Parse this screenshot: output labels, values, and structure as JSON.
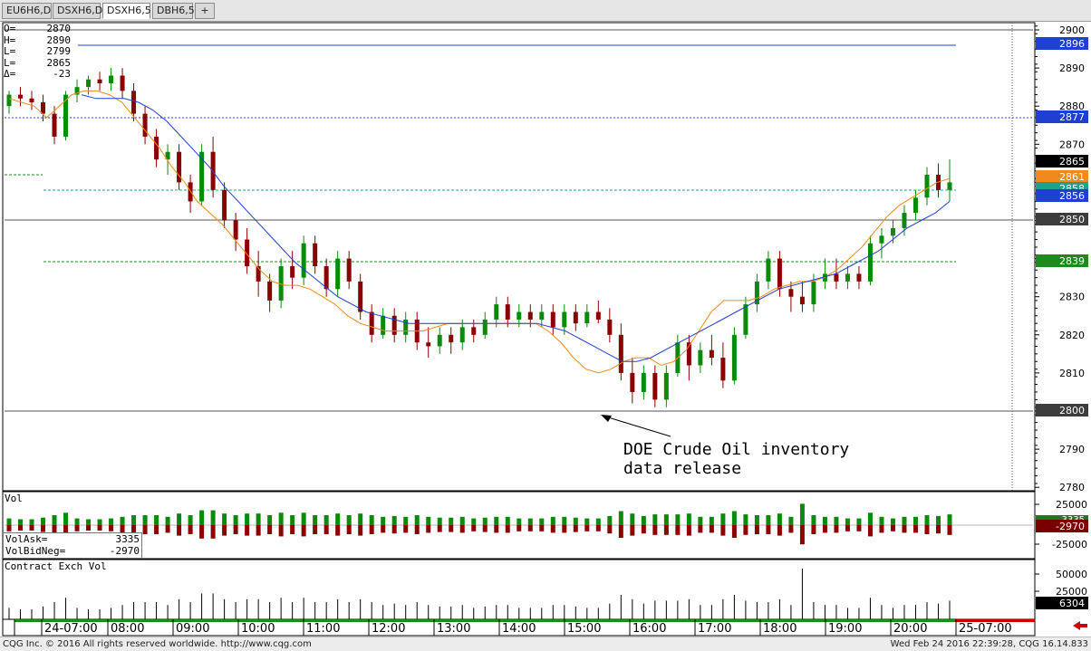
{
  "tabs": [
    {
      "label": "EU6H6,D",
      "active": false
    },
    {
      "label": "DSXH6,D",
      "active": false
    },
    {
      "label": "DSXH6,5",
      "active": true
    },
    {
      "label": "DBH6,5",
      "active": false
    },
    {
      "label": "+",
      "active": false
    }
  ],
  "ohlc": [
    {
      "label": "O=",
      "value": "2870"
    },
    {
      "label": "H=",
      "value": "2890"
    },
    {
      "label": "L=",
      "value": "2799"
    },
    {
      "label": "L=",
      "value": "2865"
    },
    {
      "label": "Δ=",
      "value": "-23"
    }
  ],
  "annotation": {
    "line1": "DOE Crude Oil inventory",
    "line2": "data release"
  },
  "price_axis": {
    "ticks": [
      "2900",
      "2890",
      "2880",
      "2870",
      "2860",
      "2850",
      "2840",
      "2830",
      "2820",
      "2810",
      "2800",
      "2790",
      "2780"
    ],
    "tags": [
      {
        "value": "2896",
        "color": "#1f3fd0"
      },
      {
        "value": "2877",
        "color": "#1f3fd0"
      },
      {
        "value": "2865",
        "color": "#000000"
      },
      {
        "value": "2861",
        "color": "#f08a1c"
      },
      {
        "value": "2858",
        "color": "#1fa090"
      },
      {
        "value": "2856",
        "color": "#1f3fd0"
      },
      {
        "value": "2850",
        "color": "#3c3c3c"
      },
      {
        "value": "2839",
        "color": "#1e8a1e"
      },
      {
        "value": "2800",
        "color": "#3c3c3c"
      }
    ]
  },
  "volume_panel": {
    "title": "Vol",
    "ticks": [
      "25000",
      "-25000"
    ],
    "tag_pos": "3335",
    "tag_neg": "-2970",
    "legend": [
      {
        "label": "VolAsk=",
        "value": "3335"
      },
      {
        "label": "VolBidNeg=",
        "value": "-2970"
      }
    ]
  },
  "contract_panel": {
    "title": "Contract Exch Vol",
    "ticks": [
      "50000",
      "25000"
    ],
    "tag": "6304"
  },
  "time_axis": [
    "24-07:00",
    "08:00",
    "09:00",
    "10:00",
    "11:00",
    "12:00",
    "13:00",
    "14:00",
    "15:00",
    "16:00",
    "17:00",
    "18:00",
    "19:00",
    "20:00",
    "25-07:00"
  ],
  "status": {
    "left": "CQG Inc. © 2016 All rights reserved worldwide. http://www.cqg.com",
    "right": "Wed Feb 24 2016 22:39:28, CQG 16.14.833"
  },
  "colors": {
    "up": "#0a8a0a",
    "down": "#8b0000",
    "ma_fast": "#f08a1c",
    "ma_slow": "#1f3fd0",
    "accent_red": "#cc0000"
  },
  "chart_data": {
    "type": "candlestick",
    "ylim": [
      2775,
      2903
    ],
    "candles": [
      [
        2880,
        2884,
        2878,
        2883
      ],
      [
        2883,
        2885,
        2880,
        2882
      ],
      [
        2882,
        2884,
        2879,
        2881
      ],
      [
        2881,
        2883,
        2876,
        2878
      ],
      [
        2878,
        2880,
        2870,
        2872
      ],
      [
        2872,
        2884,
        2871,
        2883
      ],
      [
        2883,
        2887,
        2881,
        2885
      ],
      [
        2885,
        2888,
        2883,
        2887
      ],
      [
        2887,
        2889,
        2884,
        2886
      ],
      [
        2886,
        2890,
        2884,
        2888
      ],
      [
        2888,
        2890,
        2882,
        2884
      ],
      [
        2884,
        2886,
        2876,
        2878
      ],
      [
        2878,
        2880,
        2870,
        2872
      ],
      [
        2872,
        2874,
        2864,
        2866
      ],
      [
        2866,
        2870,
        2862,
        2868
      ],
      [
        2868,
        2870,
        2858,
        2860
      ],
      [
        2860,
        2862,
        2852,
        2855
      ],
      [
        2855,
        2870,
        2854,
        2868
      ],
      [
        2868,
        2872,
        2856,
        2858
      ],
      [
        2858,
        2860,
        2848,
        2850
      ],
      [
        2850,
        2852,
        2842,
        2845
      ],
      [
        2845,
        2848,
        2836,
        2838
      ],
      [
        2838,
        2842,
        2830,
        2834
      ],
      [
        2834,
        2836,
        2826,
        2829
      ],
      [
        2829,
        2840,
        2827,
        2838
      ],
      [
        2838,
        2842,
        2832,
        2835
      ],
      [
        2835,
        2846,
        2833,
        2844
      ],
      [
        2844,
        2846,
        2836,
        2838
      ],
      [
        2838,
        2840,
        2830,
        2832
      ],
      [
        2832,
        2842,
        2830,
        2840
      ],
      [
        2840,
        2842,
        2832,
        2834
      ],
      [
        2834,
        2836,
        2824,
        2826
      ],
      [
        2826,
        2828,
        2818,
        2820
      ],
      [
        2820,
        2827,
        2819,
        2825
      ],
      [
        2825,
        2827,
        2818,
        2820
      ],
      [
        2820,
        2826,
        2818,
        2824
      ],
      [
        2824,
        2826,
        2816,
        2818
      ],
      [
        2818,
        2822,
        2814,
        2817
      ],
      [
        2817,
        2822,
        2815,
        2820
      ],
      [
        2820,
        2822,
        2815,
        2818
      ],
      [
        2818,
        2824,
        2816,
        2822
      ],
      [
        2822,
        2824,
        2818,
        2820
      ],
      [
        2820,
        2826,
        2819,
        2824
      ],
      [
        2824,
        2830,
        2822,
        2828
      ],
      [
        2828,
        2830,
        2822,
        2824
      ],
      [
        2824,
        2828,
        2822,
        2826
      ],
      [
        2826,
        2828,
        2822,
        2824
      ],
      [
        2824,
        2828,
        2822,
        2826
      ],
      [
        2826,
        2828,
        2820,
        2822
      ],
      [
        2822,
        2828,
        2820,
        2826
      ],
      [
        2826,
        2828,
        2821,
        2823
      ],
      [
        2823,
        2828,
        2822,
        2826
      ],
      [
        2826,
        2829,
        2823,
        2824
      ],
      [
        2824,
        2827,
        2818,
        2820
      ],
      [
        2820,
        2823,
        2808,
        2810
      ],
      [
        2810,
        2814,
        2802,
        2805
      ],
      [
        2805,
        2812,
        2803,
        2810
      ],
      [
        2810,
        2812,
        2801,
        2803
      ],
      [
        2803,
        2812,
        2801,
        2810
      ],
      [
        2810,
        2820,
        2809,
        2818
      ],
      [
        2818,
        2820,
        2808,
        2812
      ],
      [
        2812,
        2818,
        2810,
        2816
      ],
      [
        2816,
        2820,
        2812,
        2814
      ],
      [
        2814,
        2818,
        2806,
        2808
      ],
      [
        2808,
        2822,
        2807,
        2820
      ],
      [
        2820,
        2830,
        2819,
        2828
      ],
      [
        2828,
        2836,
        2826,
        2834
      ],
      [
        2834,
        2842,
        2832,
        2840
      ],
      [
        2840,
        2842,
        2830,
        2832
      ],
      [
        2832,
        2834,
        2826,
        2830
      ],
      [
        2830,
        2834,
        2826,
        2828
      ],
      [
        2828,
        2836,
        2826,
        2834
      ],
      [
        2834,
        2840,
        2832,
        2836
      ],
      [
        2836,
        2840,
        2832,
        2834
      ],
      [
        2834,
        2838,
        2832,
        2836
      ],
      [
        2836,
        2838,
        2832,
        2834
      ],
      [
        2834,
        2846,
        2833,
        2844
      ],
      [
        2844,
        2848,
        2840,
        2846
      ],
      [
        2846,
        2850,
        2844,
        2848
      ],
      [
        2848,
        2854,
        2846,
        2852
      ],
      [
        2852,
        2858,
        2850,
        2856
      ],
      [
        2856,
        2864,
        2854,
        2862
      ],
      [
        2862,
        2865,
        2856,
        2858
      ],
      [
        2858,
        2866,
        2855,
        2860
      ]
    ],
    "ma_fast": [
      2882,
      2881,
      2880,
      2877,
      2880,
      2883,
      2884,
      2884,
      2883,
      2881,
      2877,
      2873,
      2869,
      2864,
      2860,
      2855,
      2852,
      2849,
      2845,
      2841,
      2837,
      2834,
      2833,
      2833,
      2832,
      2830,
      2828,
      2825,
      2823,
      2822,
      2821,
      2821,
      2821,
      2821,
      2822,
      2823,
      2823,
      2823,
      2823,
      2823,
      2823,
      2823,
      2823,
      2821,
      2818,
      2814,
      2811,
      2810,
      2811,
      2813,
      2814,
      2814,
      2812,
      2813,
      2816,
      2821,
      2826,
      2829,
      2829,
      2829,
      2830,
      2832,
      2833,
      2834,
      2834,
      2835,
      2837,
      2840,
      2843,
      2847,
      2851,
      2854,
      2856,
      2858,
      2860,
      2861
    ],
    "ma_slow": [
      2883,
      2882,
      2882,
      2882,
      2881,
      2879,
      2876,
      2872,
      2868,
      2864,
      2859,
      2855,
      2851,
      2847,
      2843,
      2839,
      2836,
      2833,
      2830,
      2828,
      2826,
      2825,
      2824,
      2823,
      2823,
      2823,
      2823,
      2823,
      2823,
      2823,
      2823,
      2823,
      2823,
      2822,
      2821,
      2819,
      2817,
      2815,
      2813,
      2813,
      2814,
      2816,
      2818,
      2820,
      2822,
      2824,
      2826,
      2828,
      2830,
      2832,
      2833,
      2834,
      2835,
      2836,
      2838,
      2840,
      2842,
      2845,
      2848,
      2850,
      2852,
      2855
    ]
  }
}
